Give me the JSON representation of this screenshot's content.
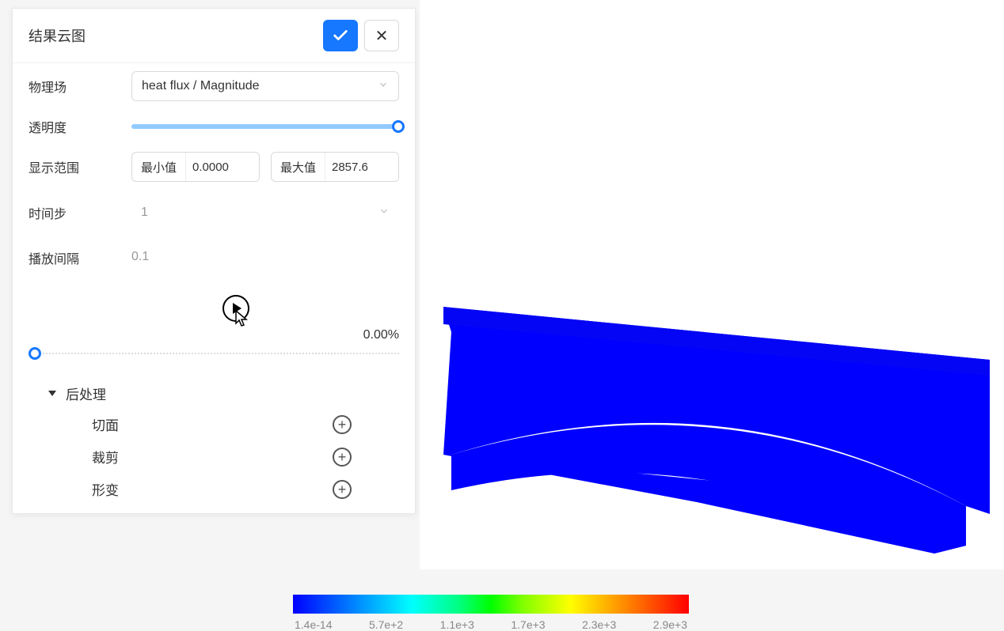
{
  "panel": {
    "title": "结果云图",
    "physical_field_label": "物理场",
    "physical_field_value": "heat flux / Magnitude",
    "opacity_label": "透明度",
    "display_range_label": "显示范围",
    "min_label": "最小值",
    "min_value": "0.0000",
    "max_label": "最大值",
    "max_value": "2857.6",
    "timestep_label": "时间步",
    "timestep_value": "1",
    "play_interval_label": "播放间隔",
    "play_interval_value": "0.1",
    "progress_text": "0.00%"
  },
  "tree": {
    "parent": "后处理",
    "items": {
      "0": {
        "label": "切面"
      },
      "1": {
        "label": "裁剪"
      },
      "2": {
        "label": "形变"
      }
    }
  },
  "colorbar": {
    "labels": {
      "0": "1.4e-14",
      "1": "5.7e+2",
      "2": "1.1e+3",
      "3": "1.7e+3",
      "4": "2.3e+3",
      "5": "2.9e+3"
    }
  }
}
